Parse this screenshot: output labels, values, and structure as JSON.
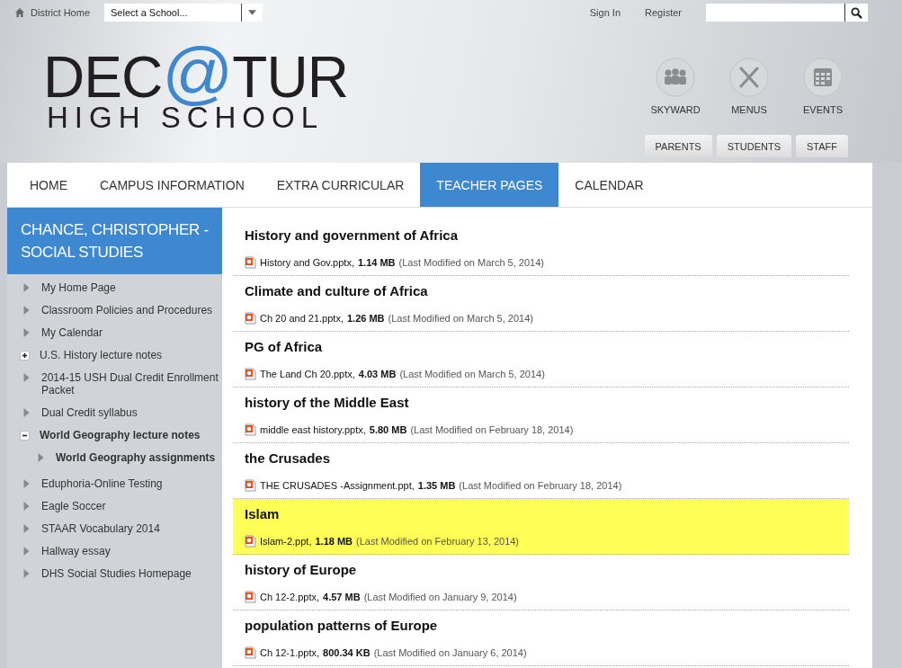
{
  "topbar": {
    "district_home": "District Home",
    "school_select": {
      "value": "Select a School..."
    },
    "sign_in": "Sign In",
    "register": "Register"
  },
  "logo": {
    "before": "DEC",
    "mark": "@",
    "after": "TUR",
    "subtitle": "HIGH SCHOOL"
  },
  "quick_links": [
    {
      "label": "SKYWARD",
      "kind": "people"
    },
    {
      "label": "MENUS",
      "kind": "utensils"
    },
    {
      "label": "EVENTS",
      "kind": "calendar"
    }
  ],
  "audience_tabs": [
    "PARENTS",
    "STUDENTS",
    "STAFF"
  ],
  "nav": [
    {
      "label": "HOME",
      "selected": false
    },
    {
      "label": "CAMPUS INFORMATION",
      "selected": false
    },
    {
      "label": "EXTRA CURRICULAR",
      "selected": false
    },
    {
      "label": "TEACHER PAGES",
      "selected": true
    },
    {
      "label": "CALENDAR",
      "selected": false
    }
  ],
  "sidebar": {
    "title": "CHANCE, CHRISTOPHER - SOCIAL STUDIES",
    "items": [
      {
        "label": "My Home Page",
        "kind": "page",
        "active": false
      },
      {
        "label": "Classroom Policies and Procedures",
        "kind": "page",
        "active": false
      },
      {
        "label": "My Calendar",
        "kind": "page",
        "active": false
      },
      {
        "label": "U.S. History lecture notes",
        "kind": "folder",
        "expanded": false,
        "active": false
      },
      {
        "label": "2014-15 USH Dual Credit Enrollment Packet",
        "kind": "page",
        "active": false
      },
      {
        "label": "Dual Credit syllabus",
        "kind": "page",
        "active": false
      },
      {
        "label": "World Geography lecture notes",
        "kind": "folder",
        "expanded": true,
        "active": true,
        "children": [
          {
            "label": "World Geography assignments",
            "kind": "page",
            "active": true
          }
        ]
      },
      {
        "label": "Eduphoria-Online Testing",
        "kind": "page",
        "active": false
      },
      {
        "label": "Eagle Soccer",
        "kind": "page",
        "active": false
      },
      {
        "label": "STAAR Vocabulary 2014",
        "kind": "page",
        "active": false
      },
      {
        "label": "Hallway essay",
        "kind": "page",
        "active": false
      },
      {
        "label": "DHS Social Studies Homepage",
        "kind": "page",
        "active": false
      }
    ]
  },
  "files": [
    {
      "title": "History and government of Africa",
      "file": "History and Gov.pptx,",
      "size": "1.14 MB",
      "modified": "(Last Modified on March 5, 2014)",
      "highlighted": false
    },
    {
      "title": "Climate and culture of Africa",
      "file": "Ch 20 and 21.pptx,",
      "size": "1.26 MB",
      "modified": "(Last Modified on March 5, 2014)",
      "highlighted": false
    },
    {
      "title": "PG of Africa",
      "file": "The Land Ch 20.pptx,",
      "size": "4.03 MB",
      "modified": "(Last Modified on March 5, 2014)",
      "highlighted": false
    },
    {
      "title": "history of the Middle East",
      "file": "middle east history.pptx,",
      "size": "5.80 MB",
      "modified": "(Last Modified on February 18, 2014)",
      "highlighted": false
    },
    {
      "title": "the Crusades",
      "file": "THE CRUSADES -Assignment.ppt,",
      "size": "1.35 MB",
      "modified": "(Last Modified on February 18, 2014)",
      "highlighted": false
    },
    {
      "title": "Islam",
      "file": "Islam-2.ppt,",
      "size": "1.18 MB",
      "modified": "(Last Modified on February 13, 2014)",
      "highlighted": true
    },
    {
      "title": "history of Europe",
      "file": "Ch 12-2.pptx,",
      "size": "4.57 MB",
      "modified": "(Last Modified on January 9, 2014)",
      "highlighted": false
    },
    {
      "title": "population patterns of Europe",
      "file": "Ch 12-1.pptx,",
      "size": "800.34 KB",
      "modified": "(Last Modified on January 6, 2014)",
      "highlighted": false
    }
  ]
}
